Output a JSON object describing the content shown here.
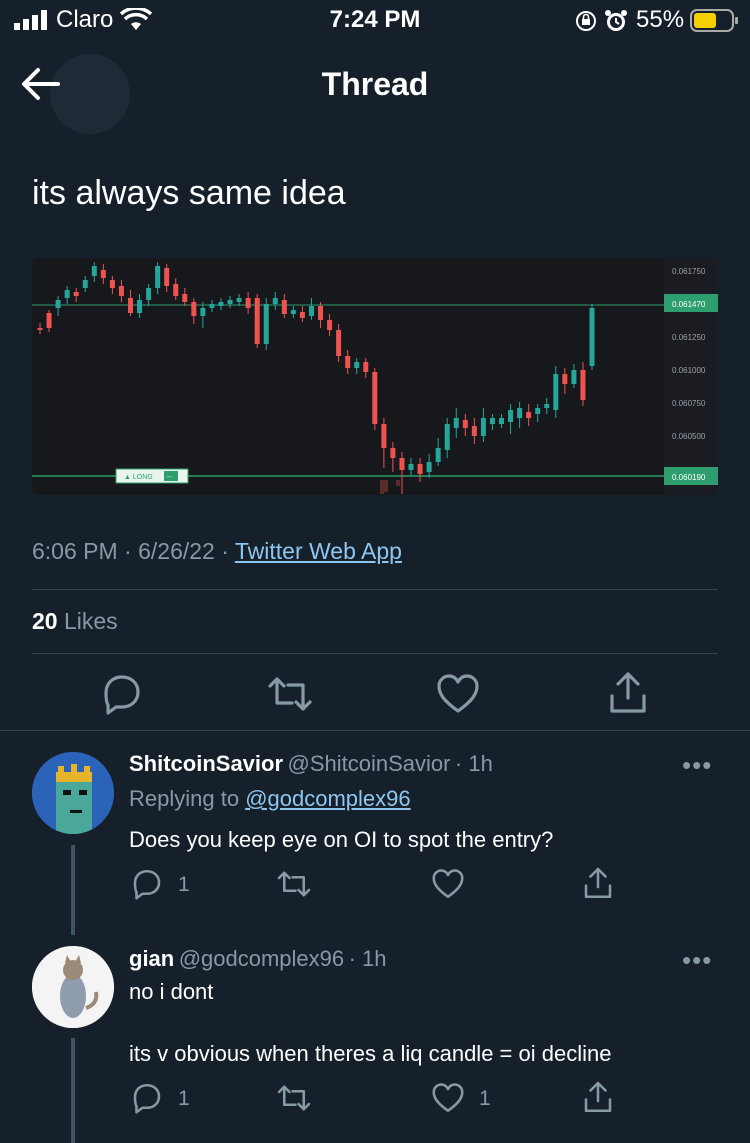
{
  "status_bar": {
    "carrier": "Claro",
    "time": "7:24 PM",
    "battery": "55%"
  },
  "header": {
    "title": "Thread"
  },
  "tweet": {
    "text": "its always same idea",
    "time": "6:06 PM",
    "date": "6/26/22",
    "source": "Twitter Web App",
    "likes_count": "20",
    "likes_label": "Likes"
  },
  "chart_image": {
    "price_labels": [
      "0.061750",
      "0.061470",
      "0.061250",
      "0.061000",
      "0.060750",
      "0.060500",
      "0.060190"
    ],
    "long_label": "▲ LONG",
    "long_tag": "--",
    "colors": {
      "up": "#26a69a",
      "down": "#ef5350",
      "background": "#17181c"
    }
  },
  "replies": [
    {
      "name": "ShitcoinSavior",
      "handle": "@ShitcoinSavior",
      "time": "· 1h",
      "replying_prefix": "Replying to",
      "replying_handle": "@godcomplex96",
      "text": "Does you keep eye on OI to spot the entry?",
      "reply_count": "1",
      "like_count": ""
    },
    {
      "name": "gian",
      "handle": "@godcomplex96",
      "time": "· 1h",
      "text_line1": "no i dont",
      "text_line2": "its v obvious when theres a liq candle = oi decline",
      "reply_count": "1",
      "like_count": "1"
    }
  ],
  "icons": [
    "back-arrow-icon",
    "reply-icon",
    "retweet-icon",
    "like-icon",
    "share-icon",
    "more-icon"
  ]
}
